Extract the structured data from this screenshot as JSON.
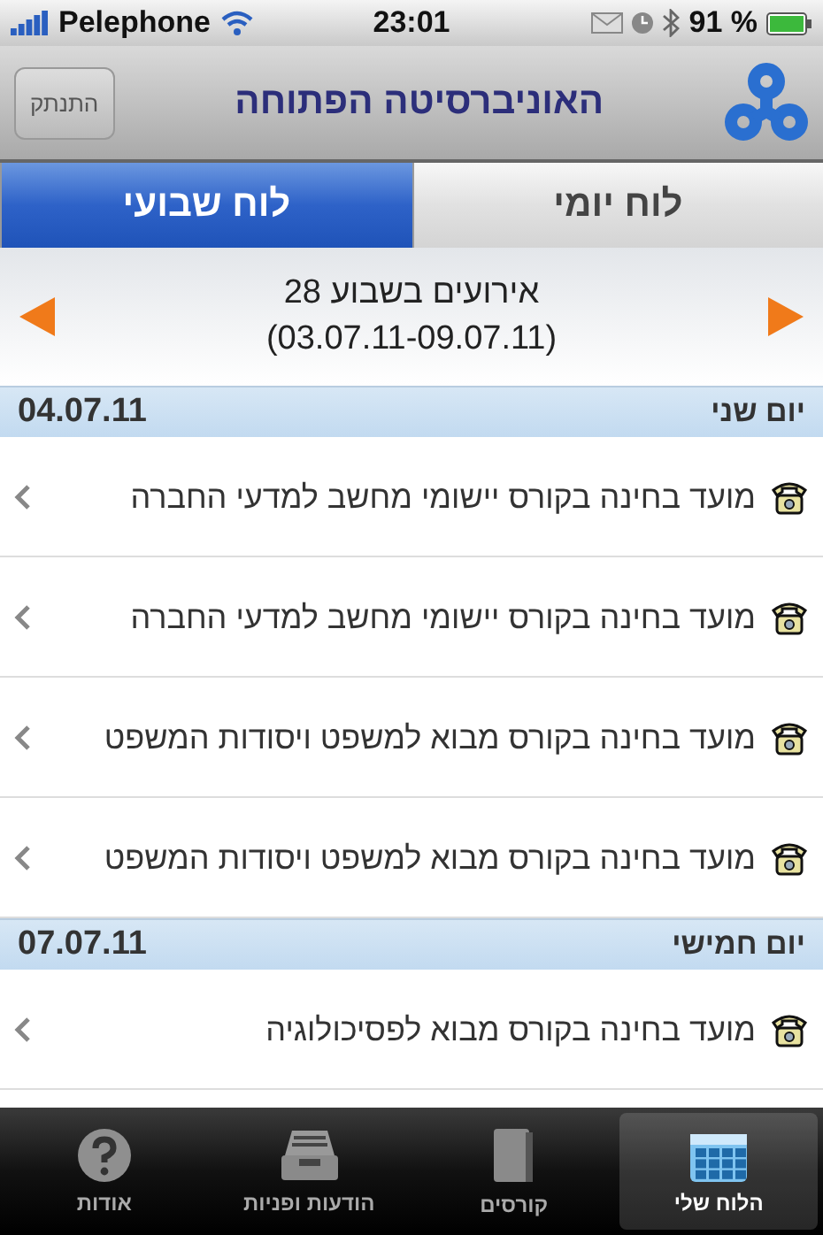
{
  "status_bar": {
    "carrier": "Pelephone",
    "time": "23:01",
    "battery": "91 %"
  },
  "nav_bar": {
    "title": "האוניברסיטה הפתוחה",
    "button": "התנתק"
  },
  "segments": [
    {
      "label": "לוח יומי",
      "selected": false
    },
    {
      "label": "לוח שבועי",
      "selected": true
    }
  ],
  "week": {
    "title": "אירועים בשבוע 28",
    "range": "(03.07.11-09.07.11)"
  },
  "days": [
    {
      "day": "יום שני",
      "date": "04.07.11",
      "events": [
        "מועד בחינה בקורס יישומי מחשב למדעי החברה",
        "מועד בחינה בקורס יישומי מחשב למדעי החברה",
        "מועד בחינה בקורס מבוא למשפט ויסודות המשפט",
        "מועד בחינה בקורס מבוא למשפט ויסודות המשפט"
      ]
    },
    {
      "day": "יום חמישי",
      "date": "07.07.11",
      "events": [
        "מועד בחינה בקורס מבוא לפסיכולוגיה"
      ]
    }
  ],
  "tab_bar": [
    {
      "kind": "calendar",
      "label": "הלוח שלי",
      "selected": true
    },
    {
      "kind": "book",
      "label": "קורסים",
      "selected": false
    },
    {
      "kind": "inbox",
      "label": "הודעות ופניות",
      "selected": false
    },
    {
      "kind": "help",
      "label": "אודות",
      "selected": false
    }
  ]
}
